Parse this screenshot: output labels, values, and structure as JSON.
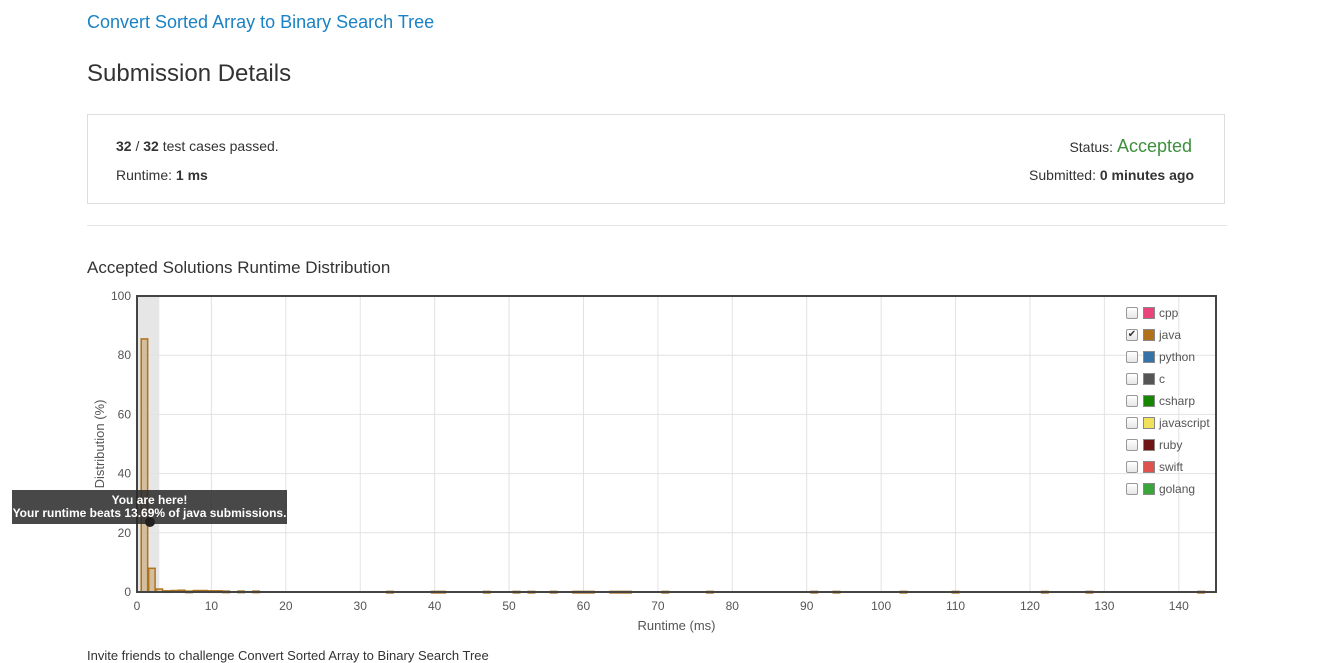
{
  "problem": {
    "title": "Convert Sorted Array to Binary Search Tree"
  },
  "page": {
    "title": "Submission Details"
  },
  "summary": {
    "passed": "32",
    "total": "32",
    "passed_suffix": "test cases passed.",
    "runtime_label": "Runtime:",
    "runtime_value": "1 ms",
    "status_label": "Status:",
    "status_value": "Accepted",
    "submitted_label": "Submitted:",
    "submitted_value": "0 minutes ago"
  },
  "distribution": {
    "title": "Accepted Solutions Runtime Distribution",
    "tooltip_line1": "You are here!",
    "tooltip_line2": "Your runtime beats 13.69% of java submissions.",
    "footer": "Invite friends to challenge Convert Sorted Array to Binary Search Tree"
  },
  "legend": [
    {
      "label": "cpp",
      "color": "#e8457a",
      "checked": false
    },
    {
      "label": "java",
      "color": "#b07219",
      "checked": true
    },
    {
      "label": "python",
      "color": "#3572a5",
      "checked": false
    },
    {
      "label": "c",
      "color": "#555555",
      "checked": false
    },
    {
      "label": "csharp",
      "color": "#178600",
      "checked": false
    },
    {
      "label": "javascript",
      "color": "#f1e05a",
      "checked": false
    },
    {
      "label": "ruby",
      "color": "#701516",
      "checked": false
    },
    {
      "label": "swift",
      "color": "#de5350",
      "checked": false
    },
    {
      "label": "golang",
      "color": "#39a53a",
      "checked": false
    }
  ],
  "chart_data": {
    "type": "bar",
    "xlabel": "Runtime (ms)",
    "ylabel": "Distribution (%)",
    "xlim": [
      0,
      145
    ],
    "ylim": [
      0,
      100
    ],
    "xticks": [
      0,
      10,
      20,
      30,
      40,
      50,
      60,
      70,
      80,
      90,
      100,
      110,
      120,
      130,
      140
    ],
    "yticks": [
      0,
      20,
      40,
      60,
      80,
      100
    ],
    "highlight_range": [
      0,
      3
    ],
    "series": [
      {
        "name": "java",
        "x": [
          1,
          2,
          3,
          4,
          5,
          6,
          7,
          8,
          9,
          10,
          11,
          12,
          14,
          16,
          34,
          40,
          41,
          47,
          51,
          53,
          56,
          59,
          60,
          61,
          64,
          65,
          66,
          71,
          77,
          91,
          94,
          103,
          110,
          122,
          128,
          143
        ],
        "values": [
          85.5,
          8.0,
          1.0,
          0.4,
          0.5,
          0.6,
          0.3,
          0.5,
          0.5,
          0.4,
          0.4,
          0.3,
          0.3,
          0.3,
          0.2,
          0.2,
          0.2,
          0.2,
          0.2,
          0.2,
          0.2,
          0.2,
          0.2,
          0.2,
          0.2,
          0.2,
          0.2,
          0.2,
          0.2,
          0.2,
          0.2,
          0.2,
          0.2,
          0.2,
          0.2,
          0.2
        ]
      }
    ]
  }
}
